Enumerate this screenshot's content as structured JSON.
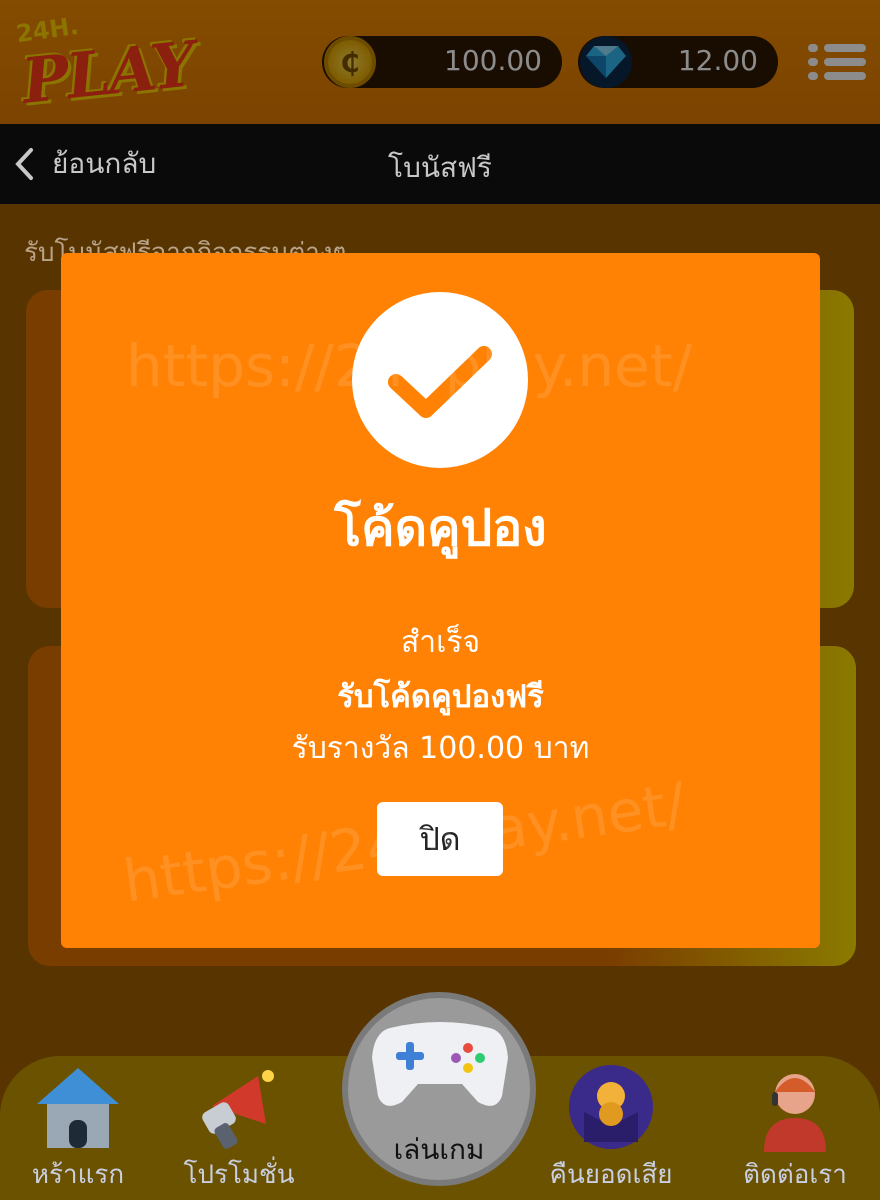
{
  "header": {
    "logo_small": "24H.",
    "logo_big": "PLAY",
    "coin_balance": "100.00",
    "gem_balance": "12.00"
  },
  "titlebar": {
    "back_label": "ย้อนกลับ",
    "title": "โบนัสฟรี"
  },
  "content": {
    "subtitle": "รับโบนัสฟรีจากกิจกรรมต่างๆ"
  },
  "watermark": "https://24hplay.net/",
  "modal": {
    "title": "โค้ดคูปอง",
    "line1": "สำเร็จ",
    "line2": "รับโค้ดคูปองฟรี",
    "line3": "รับรางวัล 100.00 บาท",
    "close_label": "ปิด"
  },
  "nav": {
    "home": "หร้าแรก",
    "promotion": "โปรโมชั่น",
    "play": "เล่นเกม",
    "cashback": "คืนยอดเสีย",
    "contact": "ติดต่อเรา"
  },
  "colors": {
    "modal_bg": "#ff8205",
    "accent": "#f08a00"
  }
}
